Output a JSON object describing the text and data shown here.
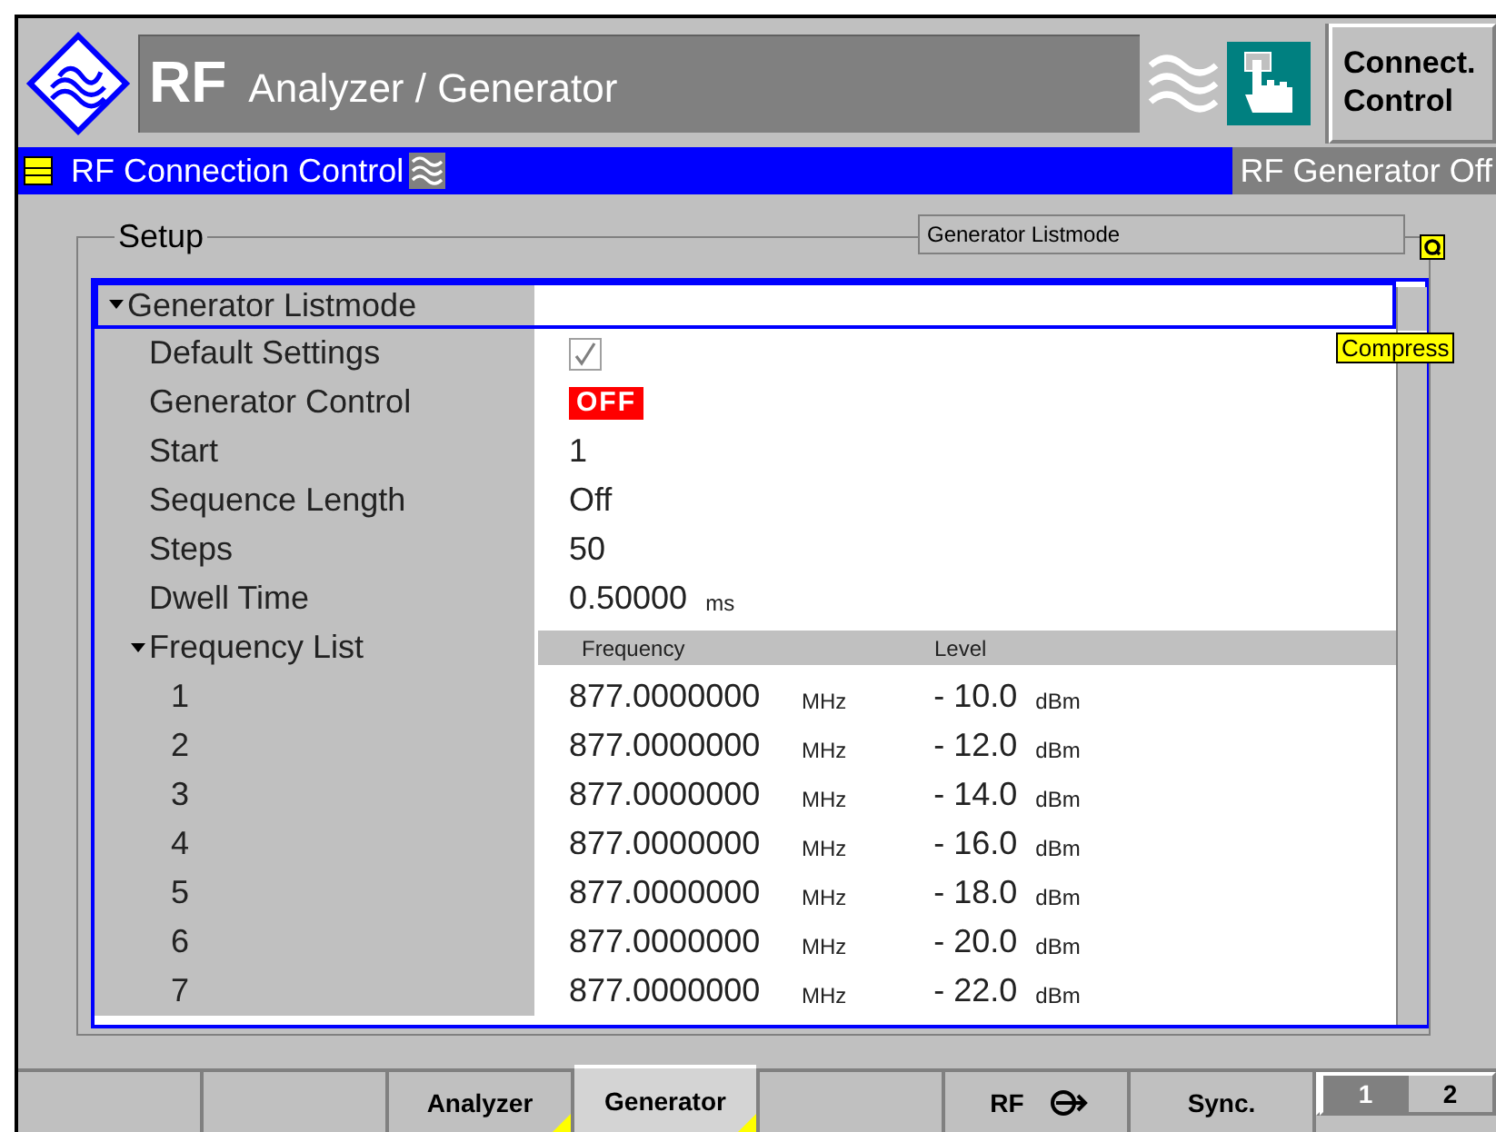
{
  "header": {
    "title_main": "RF",
    "title_sub": "Analyzer / Generator",
    "connect_button": "Connect. Control"
  },
  "menu_bar": {
    "title": "RF Connection Control",
    "status": "RF Generator Off"
  },
  "setup": {
    "legend": "Setup",
    "section_label": "Generator Listmode",
    "tooltip": "Compress"
  },
  "tree": {
    "group": {
      "label": "Generator Listmode",
      "expanded": true,
      "selected": true
    },
    "params": [
      {
        "label": "Default Settings",
        "kind": "checkbox",
        "checked": true
      },
      {
        "label": "Generator Control",
        "kind": "badge",
        "value": "OFF"
      },
      {
        "label": "Start",
        "kind": "text",
        "value": "1"
      },
      {
        "label": "Sequence Length",
        "kind": "text",
        "value": "Off"
      },
      {
        "label": "Steps",
        "kind": "text",
        "value": "50"
      },
      {
        "label": "Dwell Time",
        "kind": "text",
        "value": "0.50000",
        "unit": "ms"
      }
    ],
    "freq_list": {
      "label": "Frequency List",
      "expanded": true,
      "columns": [
        "Frequency",
        "Level"
      ],
      "rows": [
        {
          "index": "1",
          "frequency": "877.0000000",
          "frequency_unit": "MHz",
          "power": "- 10.0",
          "power_unit": "dBm"
        },
        {
          "index": "2",
          "frequency": "877.0000000",
          "frequency_unit": "MHz",
          "power": "- 12.0",
          "power_unit": "dBm"
        },
        {
          "index": "3",
          "frequency": "877.0000000",
          "frequency_unit": "MHz",
          "power": "- 14.0",
          "power_unit": "dBm"
        },
        {
          "index": "4",
          "frequency": "877.0000000",
          "frequency_unit": "MHz",
          "power": "- 16.0",
          "power_unit": "dBm"
        },
        {
          "index": "5",
          "frequency": "877.0000000",
          "frequency_unit": "MHz",
          "power": "- 18.0",
          "power_unit": "dBm"
        },
        {
          "index": "6",
          "frequency": "877.0000000",
          "frequency_unit": "MHz",
          "power": "- 20.0",
          "power_unit": "dBm"
        },
        {
          "index": "7",
          "frequency": "877.0000000",
          "frequency_unit": "MHz",
          "power": "- 22.0",
          "power_unit": "dBm"
        }
      ]
    }
  },
  "softkeys": [
    {
      "kind": "blank"
    },
    {
      "kind": "blank"
    },
    {
      "kind": "tab",
      "label": "Analyzer",
      "selected": false
    },
    {
      "kind": "tab",
      "label": "Generator",
      "selected": true
    },
    {
      "kind": "blank"
    },
    {
      "kind": "rf",
      "label": "RF"
    },
    {
      "kind": "button",
      "label": "Sync."
    },
    {
      "kind": "pages",
      "pages": [
        {
          "label": "1",
          "selected": true
        },
        {
          "label": "2",
          "selected": false
        }
      ]
    }
  ]
}
